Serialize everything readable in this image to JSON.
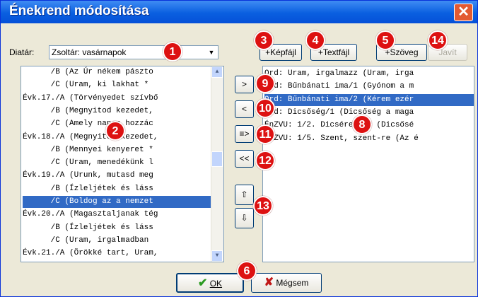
{
  "window": {
    "title": "Énekrend módosítása",
    "close": "✕"
  },
  "diatar": {
    "label": "Diatár:",
    "value": "Zsoltár: vasárnapok"
  },
  "top_buttons": {
    "kepfajl": "+Képfájl",
    "textfajl": "+Textfájl",
    "szoveg": "+Szöveg",
    "javit": "Javít"
  },
  "left_list": [
    "      /B (Az Úr nékem pászto",
    "      /C (Uram, ki lakhat *",
    "Évk.17./A (Törvényedet szívbő",
    "      /B (Megnyitod kezedet,",
    "      /C (Amely napon hozzác",
    "Évk.18./A (Megnyitod kezedet,",
    "      /B (Mennyei kenyeret *",
    "      /C (Uram, menedékünk l",
    "Évk.19./A (Urunk, mutasd meg",
    "      /B (Ízleljétek és láss",
    "      /C (Boldog az a nemzet",
    "Évk.20./A (Magasztaljanak tég",
    "      /B (Ízleljétek és láss",
    "      /C (Uram, irgalmadban",
    "Évk.21./A (Örökké tart, Uram,"
  ],
  "left_selected_index": 10,
  "right_list": [
    "Ord: Uram, irgalmazz (Uram, irga",
    "Ord: Bűnbánati ima/1 (Gyónom a m",
    "Ord: Bűnbánati ima/2 (Kérem ezér",
    "Ord: Dicsőség/1 (Dicsőség a maga",
    "ÉnZVU: 1/2. Dicséretére (Dicsősé",
    "ÉnZVU: 1/5. Szent, szent-re (Az é"
  ],
  "right_selected_index": 2,
  "mid_buttons": {
    "add": ">",
    "remove": "<",
    "insert": "≡>",
    "remove_all": "<<",
    "up": "⇧",
    "down": "⇩"
  },
  "bottom_buttons": {
    "ok": "OK",
    "cancel": "Mégsem"
  },
  "badges": {
    "b1": "1",
    "b2": "2",
    "b3": "3",
    "b4": "4",
    "b5": "5",
    "b6": "6",
    "b8": "8",
    "b9": "9",
    "b10": "10",
    "b11": "11",
    "b12": "12",
    "b13": "13",
    "b14": "14"
  },
  "colors": {
    "title_bar": "#0a5fe0",
    "selection": "#316ac5",
    "badge": "#dd1111",
    "dialog_bg": "#ece9d8"
  }
}
